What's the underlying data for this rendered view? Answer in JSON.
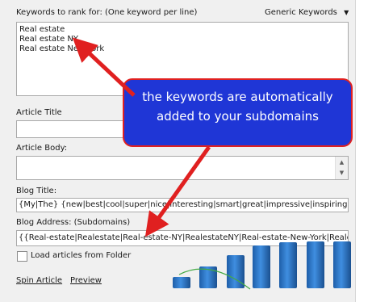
{
  "keywords_label": "Keywords to rank for: (One keyword per line)",
  "keyword_type": "Generic Keywords",
  "keywords": [
    "Real estate",
    "Real estate NY",
    "Real estate New York"
  ],
  "article_title_label": "Article Title",
  "article_title_value": "",
  "article_body_label": "Article Body:",
  "article_body_value": "",
  "blog_title_label": "Blog Title:",
  "blog_title_value": "{My|The} {new|best|cool|super|nice|interesting|smart|great|impressive|inspiring|sple",
  "blog_address_label": "Blog Address: (Subdomains)",
  "blog_address_value": "{{Real-estate|Realestate|Real-estate-NY|RealestateNY|Real-estate-New-York|Reale",
  "load_folder_label": "Load articles from Folder",
  "spin_article_label": "Spin Article",
  "preview_label": "Preview",
  "callout_text": "the keywords are automatically added to your subdomains",
  "colors": {
    "callout_bg": "#1f36d6",
    "callout_border": "#e02020",
    "arrow": "#e02020",
    "bars": "#2f7fd6",
    "growth_line": "#4caf50"
  },
  "icons": {
    "dropdown": "caret-down-icon",
    "scroll_up": "scroll-up-icon",
    "scroll_down": "scroll-down-icon"
  }
}
